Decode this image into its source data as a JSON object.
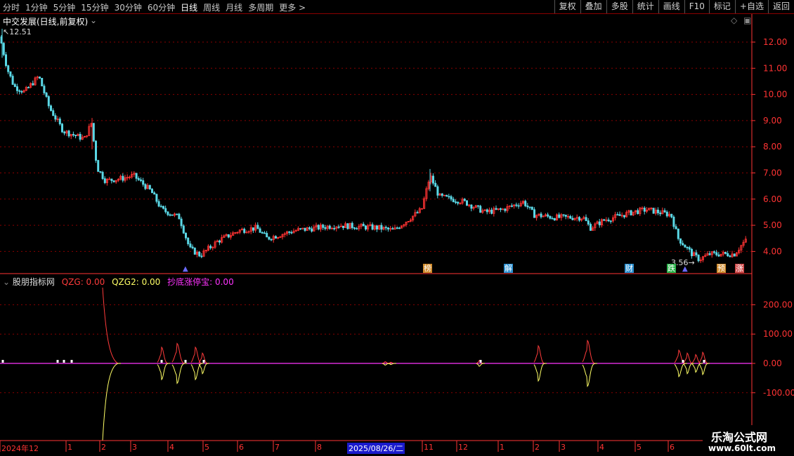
{
  "toolbar": {
    "periods": [
      "分时",
      "1分钟",
      "5分钟",
      "15分钟",
      "30分钟",
      "60分钟",
      "日线",
      "周线",
      "月线",
      "多周期",
      "更多 >"
    ],
    "active_period": "日线",
    "buttons": [
      "复权",
      "叠加",
      "多股",
      "统计",
      "画线",
      "F10",
      "标记",
      "+自选",
      "返回"
    ]
  },
  "main_chart": {
    "title": "中交发展(日线,前复权)",
    "high_label": "12.51",
    "low_label": "3.56",
    "price_axis": [
      "12.00",
      "11.00",
      "10.00",
      "9.00",
      "8.00",
      "7.00",
      "6.00",
      "5.00",
      "4.00"
    ],
    "event_markers": [
      "榜",
      "解",
      "财",
      "跌",
      "预",
      "涨"
    ]
  },
  "indicator": {
    "name": "股朋指标网",
    "lines": [
      {
        "label": "QZG: 0.00",
        "color": "#ff3b3b"
      },
      {
        "label": "QZG2: 0.00",
        "color": "#ffff66"
      },
      {
        "label": "抄底涨停宝: 0.00",
        "color": "#ff33ff"
      }
    ],
    "axis": [
      "200.00",
      "100.00",
      "0.00",
      "-100.00"
    ]
  },
  "date_axis": {
    "labels": [
      "2024年12",
      "1",
      "2",
      "3",
      "4",
      "5",
      "6",
      "7",
      "8",
      "11",
      "12",
      "1",
      "2",
      "3",
      "4",
      "5",
      "6"
    ],
    "cursor_date": "2025/08/26/二"
  },
  "watermark": {
    "line1": "乐淘公式网",
    "line2": "www.60lt.com"
  },
  "colors": {
    "up": "#ff3333",
    "down": "#5ad8e6",
    "grid": "#8b0000",
    "axis": "#ff3333"
  },
  "chart_data": {
    "type": "line",
    "title": "中交发展(日线,前复权)",
    "x": [
      "2024年12",
      "1",
      "2",
      "3",
      "4",
      "5",
      "6",
      "7",
      "8",
      "11",
      "12",
      "1",
      "2",
      "3",
      "4",
      "5",
      "6"
    ],
    "series": [
      {
        "values": [
          12.51,
          10.5,
          9.0,
          8.3,
          6.8,
          6.7,
          5.5,
          3.8,
          4.8,
          5.0,
          5.1,
          5.0,
          7.1,
          6.0,
          5.5,
          5.9,
          5.2,
          5.3,
          5.7,
          5.5,
          4.0,
          3.56,
          4.1,
          4.5
        ]
      }
    ],
    "ylim": [
      3.4,
      12.9
    ],
    "legend": "none",
    "grid": true
  }
}
